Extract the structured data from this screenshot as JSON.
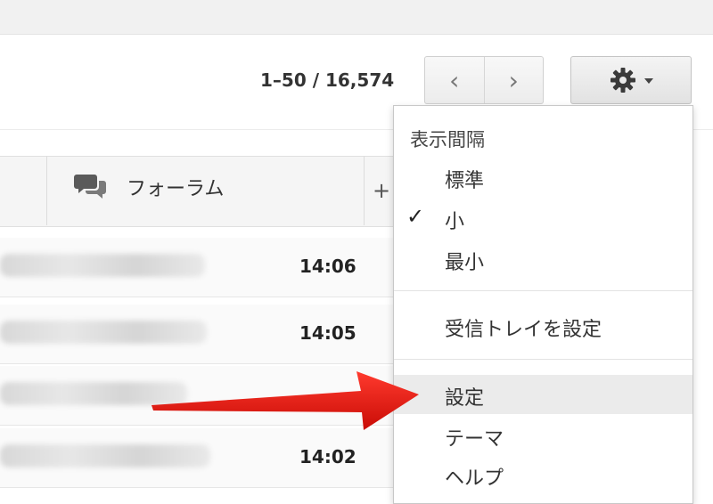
{
  "pager": {
    "range_text": "1–50 / 16,574",
    "prev_icon": "chevron-left-icon",
    "next_icon": "chevron-right-icon"
  },
  "settings_button": {
    "icon": "gear-icon",
    "caret": "caret-down-icon"
  },
  "tabs": {
    "forum": {
      "label": "フォーラム",
      "icon": "chat-bubbles-icon"
    },
    "add": {
      "label": "+"
    }
  },
  "mail_rows": [
    {
      "time": "14:06"
    },
    {
      "time": "14:05"
    },
    {
      "time": ""
    },
    {
      "time": "14:02"
    }
  ],
  "settings_menu": {
    "density_header": "表示間隔",
    "density_options": [
      {
        "label": "標準",
        "checked": false
      },
      {
        "label": "小",
        "checked": true
      },
      {
        "label": "最小",
        "checked": false
      }
    ],
    "configure_inbox": "受信トレイを設定",
    "settings": "設定",
    "themes": "テーマ",
    "help": "ヘルプ",
    "check_mark": "✓"
  },
  "annotation": {
    "arrow_color": "#e8120c"
  }
}
